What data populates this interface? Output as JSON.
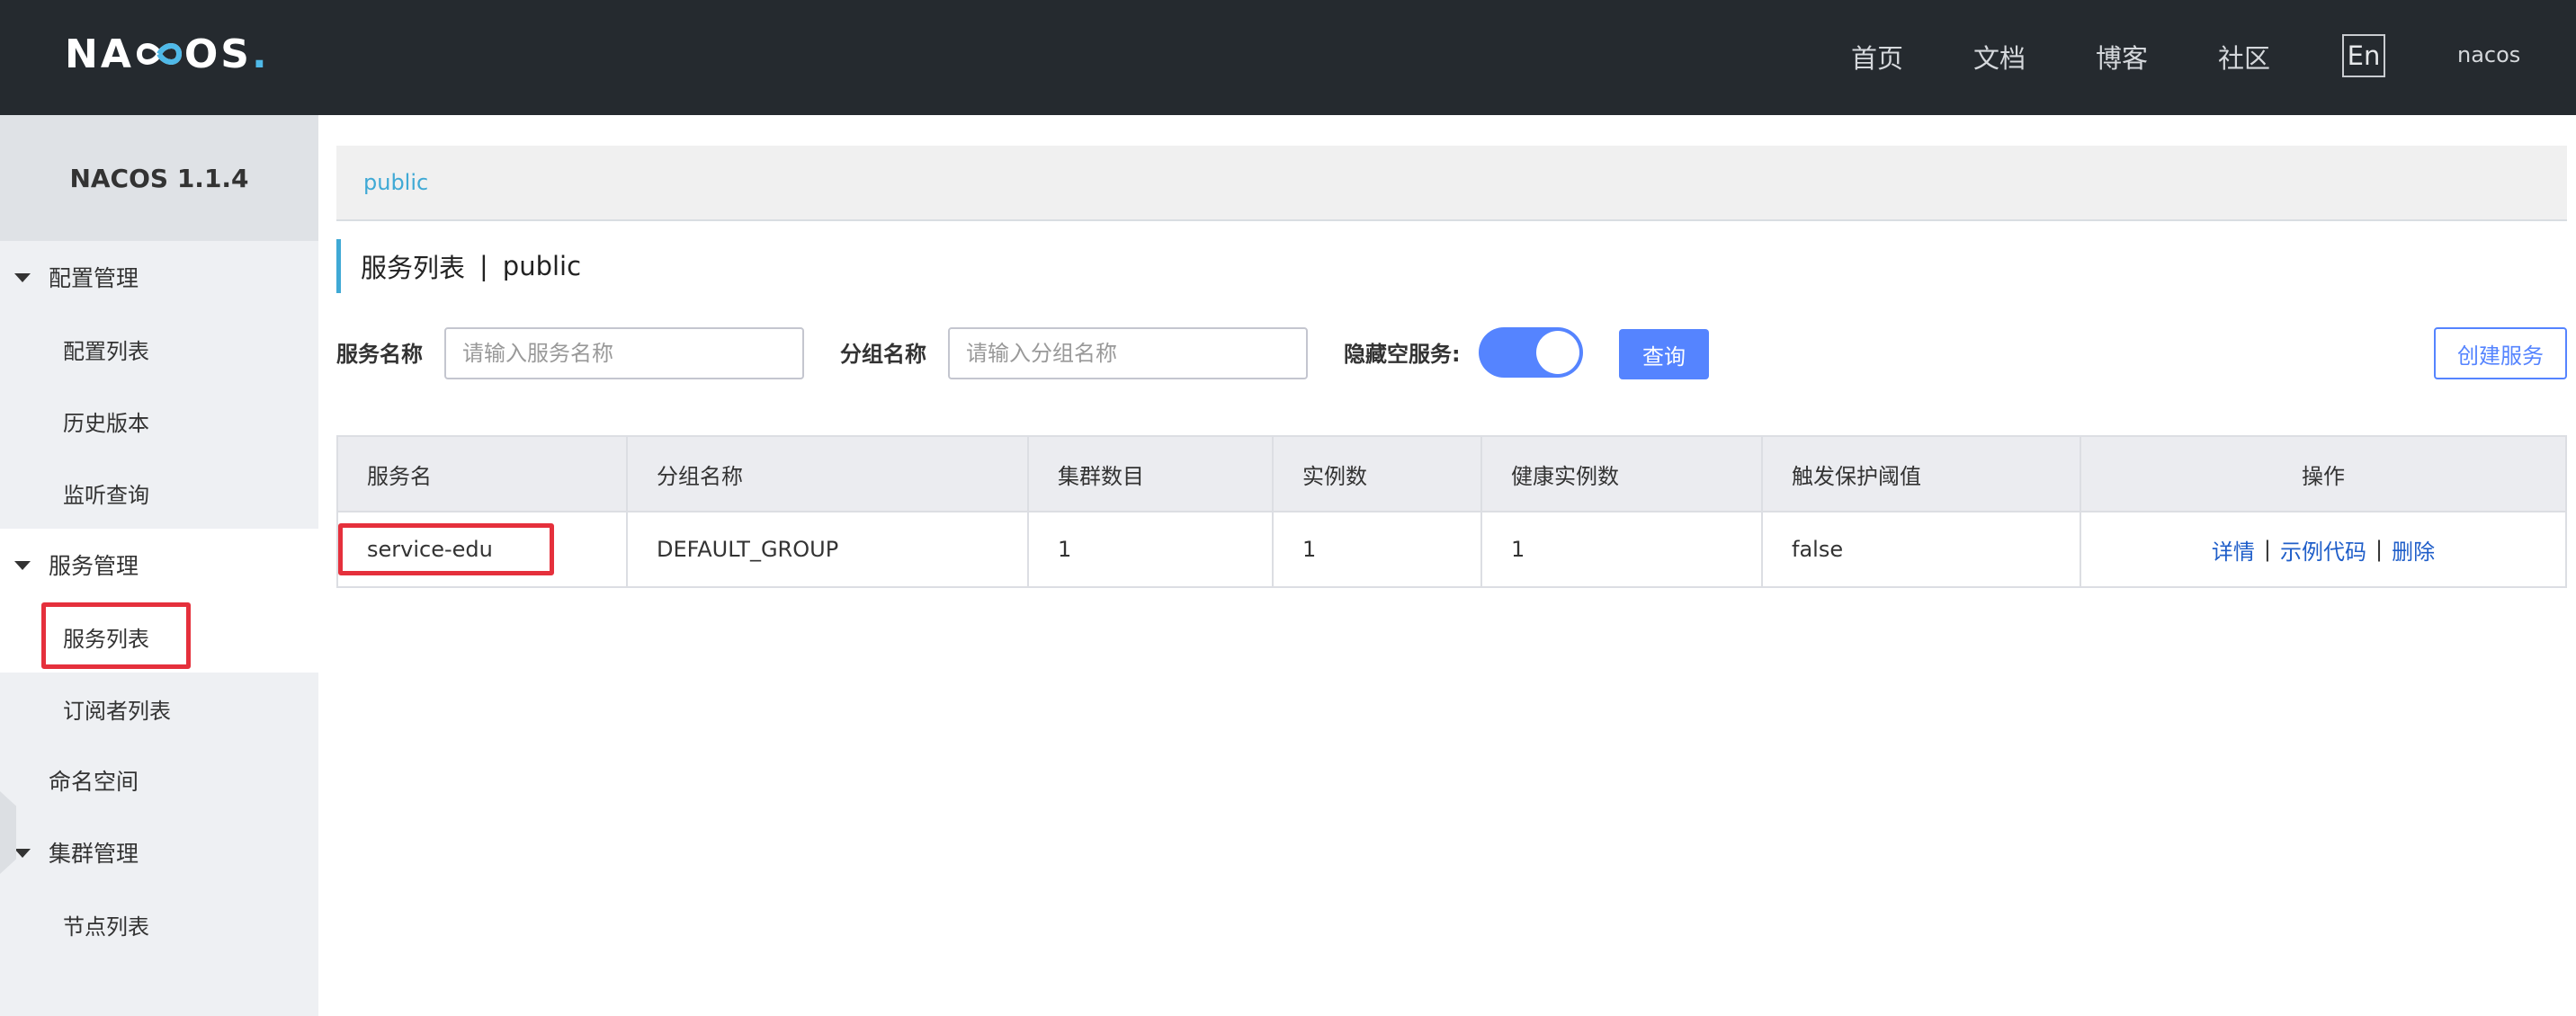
{
  "header": {
    "logo": {
      "left": "NA",
      "middle": "OS",
      "dot": "."
    },
    "nav": [
      "首页",
      "文档",
      "博客",
      "社区"
    ],
    "lang": "En",
    "user": "nacos"
  },
  "sidebar": {
    "title": "NACOS 1.1.4",
    "items": [
      {
        "label": "配置管理",
        "type": "group"
      },
      {
        "label": "配置列表",
        "type": "child"
      },
      {
        "label": "历史版本",
        "type": "child"
      },
      {
        "label": "监听查询",
        "type": "child"
      },
      {
        "label": "服务管理",
        "type": "group"
      },
      {
        "label": "服务列表",
        "type": "child",
        "active": true
      },
      {
        "label": "订阅者列表",
        "type": "child"
      },
      {
        "label": "命名空间",
        "type": "group-plain"
      },
      {
        "label": "集群管理",
        "type": "group"
      },
      {
        "label": "节点列表",
        "type": "child"
      }
    ]
  },
  "breadcrumb": "public",
  "page": {
    "title": "服务列表",
    "separator": "|",
    "namespace": "public"
  },
  "filters": {
    "service_label": "服务名称",
    "service_placeholder": "请输入服务名称",
    "group_label": "分组名称",
    "group_placeholder": "请输入分组名称",
    "hide_empty_label": "隐藏空服务:",
    "hide_empty_on": true,
    "query_button": "查询",
    "create_button": "创建服务"
  },
  "table": {
    "headers": [
      "服务名",
      "分组名称",
      "集群数目",
      "实例数",
      "健康实例数",
      "触发保护阈值",
      "操作"
    ],
    "rows": [
      {
        "cells": [
          "service-edu",
          "DEFAULT_GROUP",
          "1",
          "1",
          "1",
          "false"
        ],
        "actions": [
          "详情",
          "示例代码",
          "删除"
        ]
      }
    ]
  },
  "colors": {
    "topbar": "#252a2f",
    "accent": "#5584ff",
    "link": "#1f5ec9",
    "highlight": "#e5303c",
    "breadcrumb": "#3fa9d5"
  }
}
